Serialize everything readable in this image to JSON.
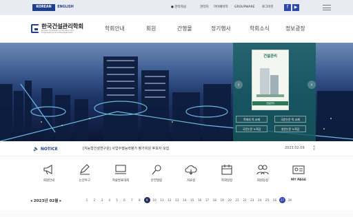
{
  "topbar": {
    "lang_korean": "KOREAN",
    "lang_english": "ENGLISH",
    "admin": "관리자님",
    "links": [
      "관리자",
      "마이페이지",
      "GROUPWARE",
      "로그아웃"
    ]
  },
  "header": {
    "logo_title": "한국건설관리학회",
    "logo_subtitle": "Korean Institute of Construction Engineering and Management",
    "nav": [
      "학회안내",
      "회원",
      "간행물",
      "정기행사",
      "학회소식",
      "정보광장"
    ]
  },
  "hero": {
    "book_title": "건설관리",
    "book_foot": "건설관리",
    "buttons": [
      "학회지 목 교재",
      "국문논문 목 교재",
      "국문논문 누적검",
      "영문논문 누적검"
    ],
    "prev": "‹",
    "next": "›"
  },
  "notice": {
    "label": "NOTICE",
    "text": "[지능형건설연구원] 사업수행능력평가 평가위원 후보자 모집",
    "date": "2023.02.09"
  },
  "quicklinks": [
    {
      "label": "회원안내",
      "icon": "megaphone-icon"
    },
    {
      "label": "논문투고",
      "icon": "pen-icon"
    },
    {
      "label": "학술발표대회",
      "icon": "monitor-icon"
    },
    {
      "label": "문헌열람",
      "icon": "magnifier-icon"
    },
    {
      "label": "자료실",
      "icon": "cloud-icon"
    },
    {
      "label": "학회일정",
      "icon": "calendar-icon"
    },
    {
      "label": "회원동정",
      "icon": "people-icon"
    },
    {
      "label": "MY PAGE",
      "icon": "id-card-icon"
    }
  ],
  "calendar": {
    "year_label": "2023년",
    "month_label": "02월",
    "prev": "◂",
    "next": "▸",
    "days": [
      "1",
      "2",
      "3",
      "4",
      "5",
      "6",
      "7",
      "8",
      "9",
      "10",
      "11",
      "12",
      "13",
      "14",
      "15",
      "16",
      "17",
      "18",
      "19",
      "20",
      "21",
      "22",
      "23",
      "24",
      "25",
      "26",
      "27",
      "28"
    ],
    "selected": "9",
    "today": "27"
  },
  "colors": {
    "brand": "#1f3f8c",
    "panel": "#165c5f"
  }
}
